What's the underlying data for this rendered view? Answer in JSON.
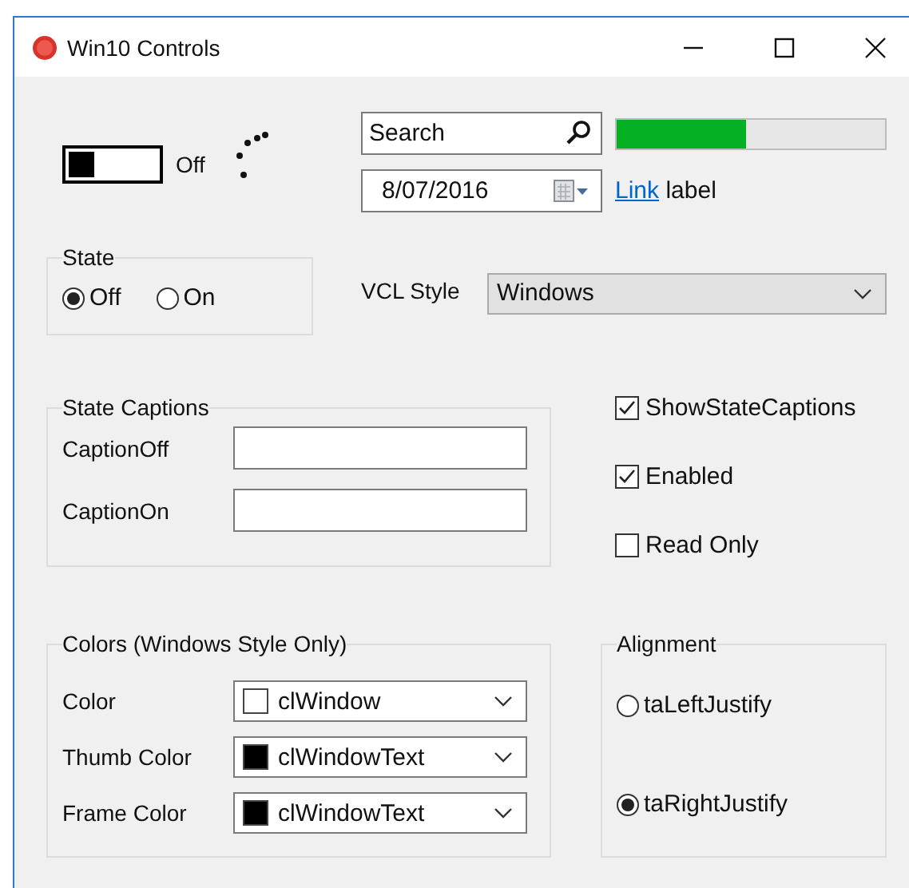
{
  "window": {
    "title": "Win10 Controls"
  },
  "toggle": {
    "on": false,
    "caption": "Off"
  },
  "search": {
    "placeholder": "Search"
  },
  "progress": {
    "level": 0.48
  },
  "date": {
    "value": "8/07/2016"
  },
  "link": {
    "link_text": "Link",
    "text": "label"
  },
  "state_group": {
    "title": "State",
    "options": [
      {
        "label": "Off",
        "selected": true
      },
      {
        "label": "On",
        "selected": false
      }
    ]
  },
  "vcl_style": {
    "label": "VCL Style",
    "value": "Windows"
  },
  "state_captions": {
    "title": "State Captions",
    "fields": [
      {
        "label": "CaptionOff"
      },
      {
        "label": "CaptionOn"
      }
    ]
  },
  "options": [
    {
      "label": "ShowStateCaptions",
      "checked": true
    },
    {
      "label": "Enabled",
      "checked": true
    },
    {
      "label": "Read Only",
      "checked": false
    }
  ],
  "colors": {
    "title": "Colors (Windows Style Only)",
    "rows": [
      {
        "label": "Color",
        "value": "clWindow",
        "color": "#ffffff"
      },
      {
        "label": "Thumb Color",
        "value": "clWindowText",
        "color": "#000000"
      },
      {
        "label": "Frame Color",
        "value": "clWindowText",
        "color": "#000000"
      }
    ]
  },
  "alignment": {
    "title": "Alignment",
    "options": [
      {
        "label": "taLeftJustify",
        "selected": false
      },
      {
        "label": "taRightJustify",
        "selected": true
      }
    ]
  }
}
